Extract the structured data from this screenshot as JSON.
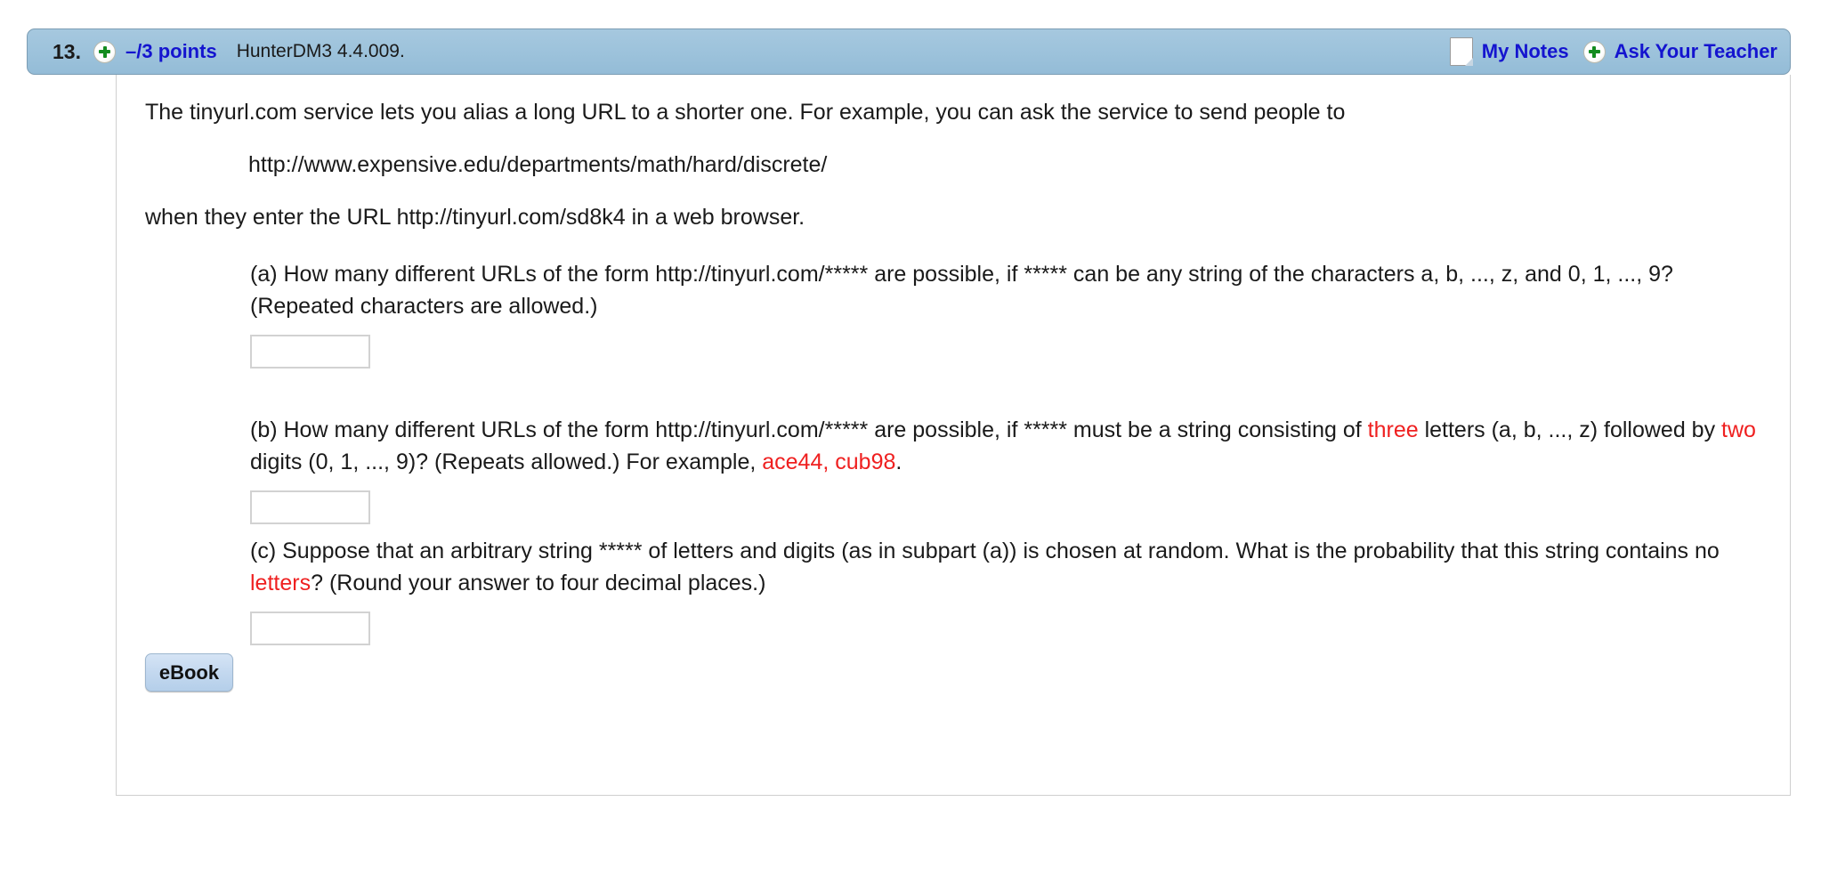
{
  "question": {
    "number": "13.",
    "points": "–/3 points",
    "code": "HunterDM3 4.4.009.",
    "add_icon": "plus-circle-icon"
  },
  "header_actions": {
    "notes_icon": "note-page-icon",
    "notes_label": "My Notes",
    "ask_icon": "plus-circle-icon",
    "ask_label": "Ask Your Teacher"
  },
  "stem": {
    "line1": "The tinyurl.com service lets you alias a long URL to a shorter one. For example, you can ask the service to send people to",
    "url": "http://www.expensive.edu/departments/math/hard/discrete/",
    "line2": "when they enter the URL http://tinyurl.com/sd8k4 in a web browser."
  },
  "parts": {
    "a": {
      "text_1": "(a) How many different URLs of the form http://tinyurl.com/***** are possible, if ***** can be any string of the characters a, b, ..., z, and 0, 1, ..., 9? (Repeated characters are allowed.)",
      "answer_value": "",
      "answer_placeholder": ""
    },
    "b": {
      "seg_1": "(b) How many different URLs of the form http://tinyurl.com/***** are possible, if ***** must be a string consisting of ",
      "red_1": "three",
      "seg_2": " letters (a, b, ..., z) followed by ",
      "red_2": "two",
      "seg_3": " digits (0, 1, ..., 9)? (Repeats allowed.) For example, ",
      "red_3": "ace44, cub98",
      "seg_4": ".",
      "answer_value": "",
      "answer_placeholder": ""
    },
    "c": {
      "seg_1": "(c) Suppose that an arbitrary string ***** of letters and digits (as in subpart (a)) is chosen at random. What is the probability that this string contains no ",
      "red_1": "letters",
      "seg_2": "? (Round your answer to four decimal places.)",
      "answer_value": "",
      "answer_placeholder": ""
    }
  },
  "footer": {
    "ebook_label": "eBook"
  },
  "colors": {
    "header_bg": "#9cc2db",
    "link_blue": "#1414cf",
    "highlight_red": "#ef2020",
    "plus_green": "#138c1f"
  }
}
